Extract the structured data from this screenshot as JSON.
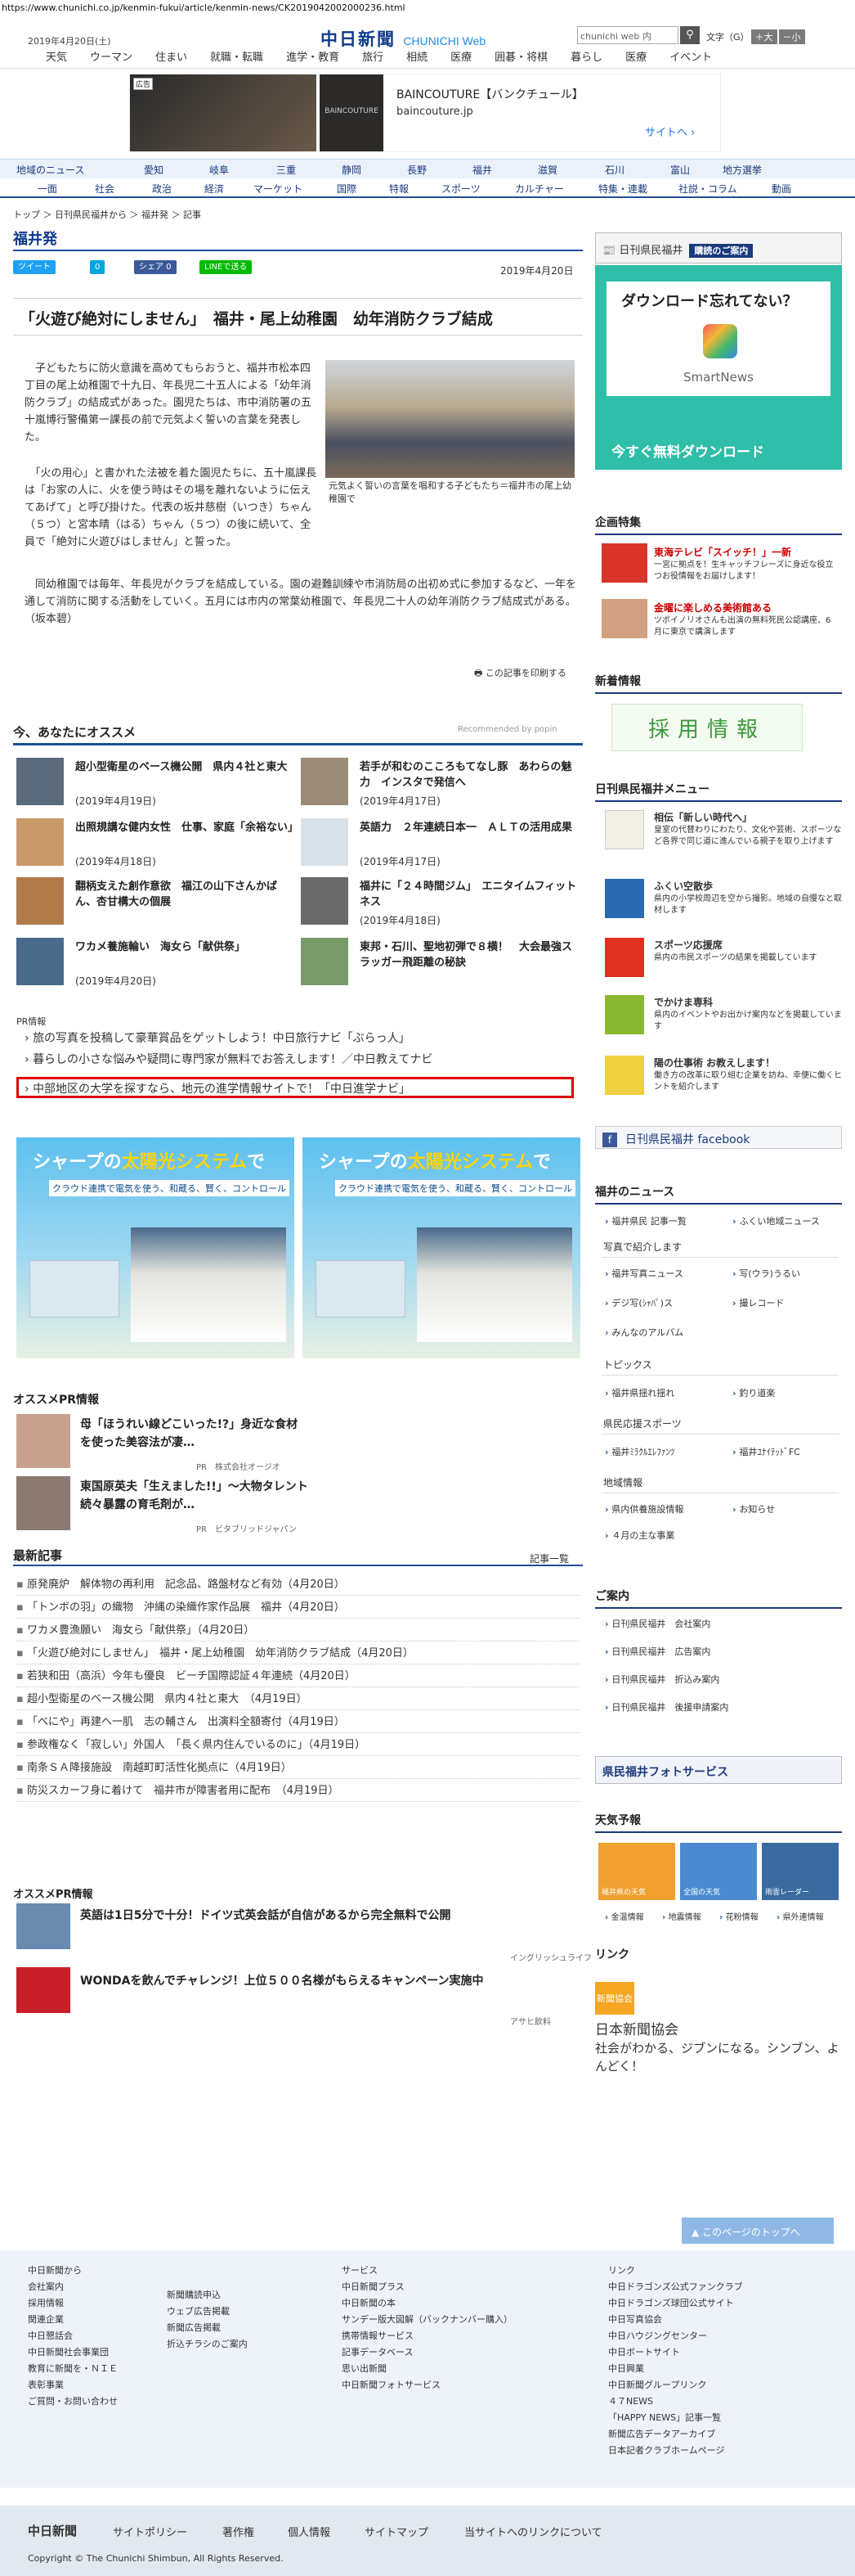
{
  "url": "https://www.chunichi.co.jp/kenmin-fukui/article/kenmin-news/CK2019042002000236.html",
  "header": {
    "date": "2019年4月20日(土)",
    "logo": "中日新聞",
    "logo_sub": "CHUNICHI Web",
    "search_placeholder": "chunichi web 内",
    "text_label": "文字（G）",
    "plus": "＋大",
    "minus": "－小"
  },
  "gnav": [
    "天気",
    "ウーマン",
    "住まい",
    "就職・転職",
    "進学・教育",
    "旅行",
    "相続",
    "医療",
    "囲碁・将棋",
    "暮らし",
    "医療",
    "イベント"
  ],
  "ad": {
    "label": "広告",
    "logo": "BAINCOUTURE",
    "title": "BAINCOUTURE【バンクチュール】",
    "url": "baincouture.jp",
    "site": "サイトへ"
  },
  "cnav1": [
    "地域のニュース",
    "愛知",
    "岐阜",
    "三重",
    "静岡",
    "長野",
    "福井",
    "滋賀",
    "石川",
    "富山",
    "地方選挙"
  ],
  "cnav2": [
    "一面",
    "社会",
    "政治",
    "経済",
    "マーケット",
    "国際",
    "特報",
    "スポーツ",
    "カルチャー",
    "特集・連載",
    "社説・コラム",
    "動画"
  ],
  "crumb": "トップ ＞ 日刊県民福井から ＞ 福井発 ＞ 記事",
  "section": "福井発",
  "share": {
    "tweet": "ツイート",
    "b": "0",
    "fb": "シェア 0",
    "line": "LINEで送る"
  },
  "article": {
    "date": "2019年4月20日",
    "headline": "「火遊び絶対にしません」　福井・尾上幼稚園　幼年消防クラブ結成",
    "p1": "　子どもたちに防火意識を高めてもらおうと、福井市松本四丁目の尾上幼稚園で十九日、年長児二十五人による「幼年消防クラブ」の結成式があった。園児たちは、市中消防署の五十嵐博行警備第一課長の前で元気よく誓いの言葉を発表した。",
    "p2": "　「火の用心」と書かれた法被を着た園児たちに、五十嵐課長は「お家の人に、火を使う時はその場を離れないように伝えてあげて」と呼び掛けた。代表の坂井慈樹（いつき）ちゃん（５つ）と宮本晴（はる）ちゃん（５つ）の後に続いて、全員で「絶対に火遊びはしません」と誓った。",
    "p3": "　同幼稚園では毎年、年長児がクラブを結成している。園の避難訓練や市消防局の出初め式に参加するなど、一年を通して消防に関する活動をしていく。五月には市内の常葉幼稚園で、年長児二十人の幼年消防クラブ結成式がある。　（坂本碧）",
    "caption": "元気よく誓いの言葉を唱和する子どもたち＝福井市の尾上幼稚園で",
    "print": "この記事を印刷する"
  },
  "rec": {
    "title": "今、あなたにオススメ",
    "by": "Recommended by popin",
    "items": [
      {
        "t": "超小型衛星のベース機公開　県内４社と東大",
        "d": "(2019年4月19日)"
      },
      {
        "t": "若手が和むのこころもてなし豚　あわらの魅力　インスタで発信へ",
        "d": "(2019年4月17日)"
      },
      {
        "t": "出照規講な健内女性　仕事、家庭「余裕ない」",
        "d": "(2019年4月18日)"
      },
      {
        "t": "英語力　２年連続日本一　ＡＬＴの活用成果",
        "d": "(2019年4月17日)"
      },
      {
        "t": "翻柄支えた創作意欲　福江の山下さんかばん、杏甘構大の個展",
        "d": ""
      },
      {
        "t": "福井に「２４時間ジム」　エニタイムフィットネス",
        "d": "(2019年4月18日)"
      },
      {
        "t": "ワカメ養施輪い　海女ら「献供祭」",
        "d": "(2019年4月20日)"
      },
      {
        "t": "東邦・石川、聖地初弾で８横！　大会最強スラッガー飛距離の秘訣",
        "d": ""
      }
    ]
  },
  "pr": {
    "label": "PR情報",
    "links": [
      "旅の写真を投稿して豪華賞品をゲットしよう！中日旅行ナビ「ぶらっ人」",
      "暮らしの小さな悩みや疑問に専門家が無料でお答えします！／中日教えてナビ",
      "中部地区の大学を探すなら、地元の進学情報サイトで！「中日進学ナビ」"
    ]
  },
  "sharp": {
    "h1": "シャープの",
    "h2": "太陽光システム",
    "h3": "で",
    "sub": "クラウド連携で電気を使う、和蔵る、賢く、コントロール"
  },
  "osusume": {
    "title": "オススメPR情報",
    "items": [
      {
        "t": "母「ほうれい線どこいった!?」身近な食材を使った美容法が凄…",
        "a": "PR　株式会社オージオ"
      },
      {
        "t": "東国原英夫「生えました!!」〜大物タレント続々暴露の育毛剤が…",
        "a": "PR　ビタブリッドジャパン"
      }
    ]
  },
  "latest": {
    "title": "最新記事",
    "more": "記事一覧",
    "items": [
      "原発廃炉　解体物の再利用　記念品、路盤材など有効（4月20日）",
      "「トンボの羽」の織物　沖縄の染織作家作品展　福井（4月20日）",
      "ワカメ豊漁願い　海女ら「献供祭」（4月20日）",
      "「火遊び絶対にしません」　福井・尾上幼稚園　幼年消防クラブ結成（4月20日）",
      "若狭和田（高浜）今年も優良　ビーチ国際認証４年連続（4月20日）",
      "超小型衛星のベース機公開　県内４社と東大　（4月19日）",
      "「べにや」再建へ一肌　志の輔さん　出演料全額寄付（4月19日）",
      "参政権なく「寂しい」外国人　「長く県内住んでいるのに」（4月19日）",
      "南条ＳＡ降接施設　南越町町活性化拠点に（4月19日）",
      "防災スカーフ身に着けて　福井市が障害者用に配布　（4月19日）"
    ]
  },
  "pr2": {
    "title": "オススメPR情報",
    "items": [
      {
        "t": "英語は1日5分で十分！ドイツ式英会話が自信があるから完全無料で公開",
        "a": "イングリッシュライフ"
      },
      {
        "t": "WONDAを飲んでチャレンジ！上位５００名様がもらえるキャンペーン実施中",
        "a": "アサヒ飲料"
      }
    ]
  },
  "right": {
    "banner": "日刊県民福井",
    "banner_btn": "購読のご案内",
    "snad": {
      "q": "ダウンロード忘れてない？",
      "name": "SmartNews",
      "dl": "今すぐ無料ダウンロード"
    },
    "kikaku": {
      "title": "企画特集",
      "items": [
        {
          "t": "東海テレビ「スイッチ！」一新",
          "d": "一宮に拠点を！生キャッチフレーズに身近な役立つお役情報をお届けします！"
        },
        {
          "t": "金曜に楽しめる美術館ある",
          "d": "ツボイノリオさんも出演の無料死民公認講座、6月に東京で講演します"
        }
      ]
    },
    "shinsotsu": "新着情報",
    "saiyo": "採用情報",
    "menu_title": "日刊県民福井メニュー",
    "menu": [
      {
        "t": "相伝「新しい時代へ」",
        "d": "皇室の代替わりにわたり、文化や芸術、スポーツなど各界で同じ道に進んでいる親子を取り上げます"
      },
      {
        "t": "ふくい空散歩",
        "d": "県内の小学校周辺を空から撮影。地域の自慢なと取材します"
      },
      {
        "t": "スポーツ応援席",
        "d": "県内の市民スポーツの結果を掲載しています"
      },
      {
        "t": "でかけま専科",
        "d": "県内のイベントやお出かけ案内などを掲載しています"
      },
      {
        "t": "陽の仕事術 お教えします！",
        "d": "働き方の改革に取り組む企業を訪ね、幸便に働くヒントを紹介します"
      }
    ],
    "fb": "日刊県民福井 facebook",
    "fnews": "福井のニュース",
    "links1": [
      "福井県民 記事一覧",
      "ふくい地域ニュース"
    ],
    "photo_title": "写真で紹介します",
    "links2": [
      "福井写真ニュース",
      "写(ウラ)うるい",
      "デジ写(ｼｬﾊﾟ)ス",
      "撮レコード",
      "みんなのアルバム"
    ],
    "topics": "トピックス",
    "links3": [
      "福井県揺れ揺れ",
      "釣り道楽"
    ],
    "sports": "県民応援スポーツ",
    "links4": [
      "福井ﾐﾗｸﾙｴﾚﾌｧﾝﾂ",
      "福井ﾕﾅｲﾃｯﾄﾞFC"
    ],
    "region": "地域情報",
    "links5": [
      "県内供養施設情報",
      "お知らせ",
      "４月の主な事業"
    ],
    "guide": "ご案内",
    "links6": [
      "日刊県民福井　会社案内",
      "日刊県民福井　広告案内",
      "日刊県民福井　折込み案内",
      "日刊県民福井　後援申請案内"
    ],
    "photo_svc": "県民福井フォトサービス",
    "weather_title": "天気予報",
    "weather": [
      "福井県の天気",
      "全国の天気",
      "雨雲レーダー"
    ],
    "weather_links": [
      "金温情報",
      "地震情報",
      "花粉情報",
      "県外連情報"
    ],
    "link_title": "リンク",
    "jnpa": "新聞協会",
    "jnpa_name": "日本新聞協会",
    "jnpa_desc": "社会がわかる、ジブンになる。シンブン、よんどく！"
  },
  "totop": "このページのトップへ",
  "footer": {
    "c1h": "中日新聞から",
    "c1": [
      "会社案内",
      "採用情報",
      "関連企業",
      "中日懇話会",
      "中日新聞社会事業団",
      "教育に新聞を・ＮＩＥ",
      "表彰事業",
      "ご質問・お問い合わせ"
    ],
    "c2": [
      "新聞購読申込",
      "ウェブ広告掲載",
      "新聞広告掲載",
      "折込チラシのご案内"
    ],
    "c3h": "サービス",
    "c3": [
      "中日新聞プラス",
      "中日新聞の本",
      "サンデー版大図解（バックナンバー購入）",
      "携帯情報サービス",
      "記事データベース",
      "思い出新聞",
      "中日新聞フォトサービス"
    ],
    "c4h": "リンク",
    "c4": [
      "中日ドラゴンズ公式ファンクラブ",
      "中日ドラゴンズ球団公式サイト",
      "中日写真協会",
      "中日ハウジングセンター",
      "中日ボートサイト",
      "中日興業",
      "中日新聞グループリンク",
      "４７NEWS",
      "「HAPPY NEWS」記事一覧",
      "新聞広告データアーカイブ",
      "日本記者クラブホームページ"
    ],
    "logo": "中日新聞",
    "nav": [
      "サイトポリシー",
      "著作権",
      "個人情報",
      "サイトマップ",
      "当サイトへのリンクについて"
    ],
    "copy": "Copyright © The Chunichi Shimbun, All Rights Reserved."
  }
}
